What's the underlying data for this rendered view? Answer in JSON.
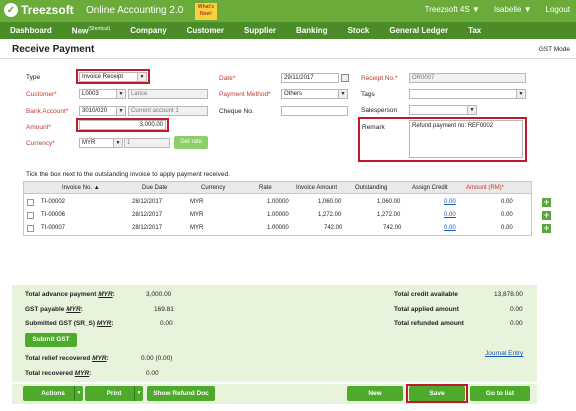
{
  "app": {
    "logo": "Treezsoft",
    "subtitle": "Online Accounting 2.0",
    "whats_new": "What's New!",
    "company": "Treezsoft 4S ▼",
    "user": "Isabelle ▼",
    "logout": "Logout"
  },
  "nav": [
    {
      "label": "Dashboard"
    },
    {
      "label": "New",
      "sup": "(Shortcut)"
    },
    {
      "label": "Company"
    },
    {
      "label": "Customer"
    },
    {
      "label": "Supplier"
    },
    {
      "label": "Banking"
    },
    {
      "label": "Stock"
    },
    {
      "label": "General Ledger"
    },
    {
      "label": "Tax"
    }
  ],
  "page": {
    "title": "Receive Payment",
    "gst_mode": "GST Mode"
  },
  "form": {
    "type_label": "Type",
    "type_value": "Invoice Receipt",
    "customer_label": "Customer*",
    "customer_code": "L0003",
    "customer_name": "Lance",
    "bank_label": "Bank Account*",
    "bank_code": "3010/020",
    "bank_name": "Current account 1",
    "amount_label": "Amount*",
    "amount_value": "3,000.00",
    "currency_label": "Currency*",
    "currency_value": "MYR",
    "rate_value": "1",
    "get_rate": "Get rate",
    "date_label": "Date*",
    "date_value": "29/11/2017",
    "method_label": "Payment Method*",
    "method_value": "Others",
    "cheque_label": "Cheque No.",
    "cheque_value": "",
    "receipt_label": "Receipt No.*",
    "receipt_value": "OR0007",
    "tags_label": "Tags",
    "tags_value": "",
    "sales_label": "Salesperson",
    "sales_value": "",
    "remark_label": "Remark",
    "remark_value": "Refund payment no: REF0002"
  },
  "grid": {
    "hint": "Tick the box next to the outstanding invoice to apply payment received.",
    "headers": {
      "invoice": "Invoice No.",
      "due": "Due Date",
      "currency": "Currency",
      "rate": "Rate",
      "inv_amount": "Invoice Amount",
      "outstanding": "Outstanding",
      "assign": "Assign Credit",
      "amount": "Amount (RM)*"
    },
    "rows": [
      {
        "invoice": "TI-00002",
        "due": "28/12/2017",
        "currency": "MYR",
        "rate": "1.00000",
        "inv_amount": "1,060.00",
        "outstanding": "1,060.00",
        "assign": "0.00",
        "amount": "0.00"
      },
      {
        "invoice": "TI-00006",
        "due": "28/12/2017",
        "currency": "MYR",
        "rate": "1.00000",
        "inv_amount": "1,272.00",
        "outstanding": "1,272.00",
        "assign": "0.00",
        "amount": "0.00"
      },
      {
        "invoice": "TI-00007",
        "due": "28/12/2017",
        "currency": "MYR",
        "rate": "1.00000",
        "inv_amount": "742.00",
        "outstanding": "742.00",
        "assign": "0.00",
        "amount": "0.00"
      }
    ]
  },
  "summary": {
    "advance_label": "Total advance payment",
    "advance_cur": "MYR",
    "advance_value": "3,000.00",
    "gst_payable_label": "GST payable",
    "gst_payable_cur": "MYR",
    "gst_payable_value": "169.81",
    "submitted_label": "Submitted GST (SR_S)",
    "submitted_cur": "MYR",
    "submitted_value": "0.00",
    "submit_button": "Submit GST",
    "relief_label": "Total relief recovered",
    "relief_cur": "MYR",
    "relief_value": "0.00 (0.00)",
    "recovered_label": "Total recovered",
    "recovered_cur": "MYR",
    "recovered_value": "0.00",
    "credit_avail_label": "Total credit available",
    "credit_avail_value": "13,878.00",
    "applied_label": "Total applied amount",
    "applied_value": "0.00",
    "refunded_label": "Total refunded amount",
    "refunded_value": "0.00",
    "journal_entry": "Journal Entry"
  },
  "footer": {
    "actions": "Actions",
    "print": "Print",
    "show_refund": "Show Refund Doc",
    "new": "New",
    "save": "Save",
    "go_to_list": "Go to list"
  }
}
